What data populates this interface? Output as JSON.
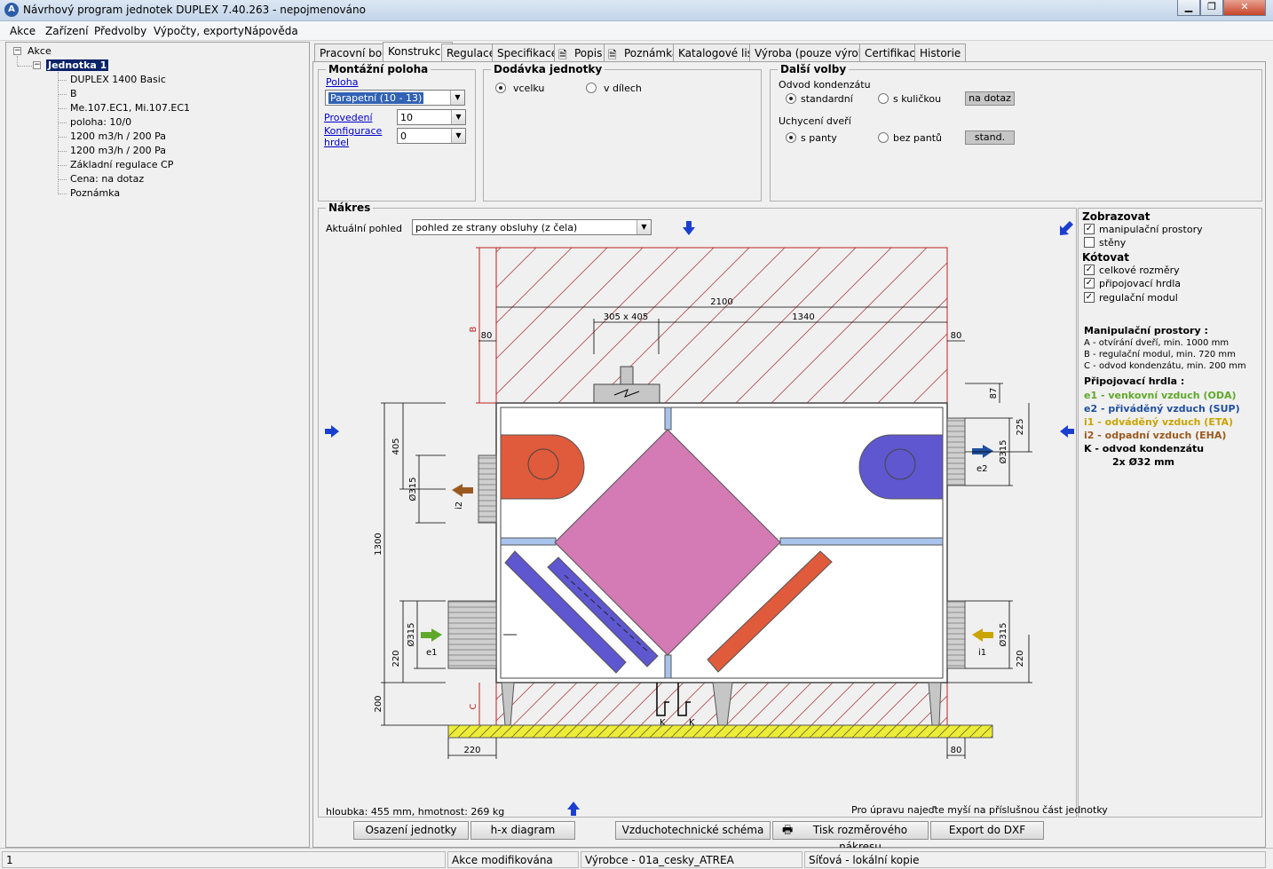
{
  "window": {
    "title": "Návrhový program jednotek DUPLEX 7.40.263 - nepojmenováno",
    "icon_name": "app-icon",
    "controls": [
      "minimize-icon",
      "restore-icon",
      "close-icon"
    ]
  },
  "menu": {
    "items": [
      "Akce",
      "Zařízení",
      "Předvolby",
      "Výpočty, exporty",
      "Nápověda"
    ]
  },
  "tree": {
    "root": "Akce",
    "unit": "Jednotka 1",
    "children": [
      "DUPLEX 1400 Basic",
      "B",
      "Me.107.EC1, Mi.107.EC1",
      "poloha: 10/0",
      "1200 m3/h / 200 Pa",
      "1200 m3/h / 200 Pa",
      "Základní regulace CP",
      "Cena: na dotaz",
      "Poznámka"
    ]
  },
  "tabs": [
    "Pracovní bod",
    "Konstrukce",
    "Regulace",
    "Specifikace",
    "Popis",
    "Poznámka",
    "Katalogové listy",
    "Výroba (pouze výrobce)",
    "Certifikace",
    "Historie"
  ],
  "active_tab": "Konstrukce",
  "mount": {
    "title": "Montážní poloha",
    "poloha_label": "Poloha",
    "poloha_value": "Parapetní   (10 - 13)",
    "provedeni_label": "Provedení",
    "provedeni_value": "10",
    "konfigurace_label_1": "Konfigurace",
    "konfigurace_label_2": "hrdel",
    "konfigurace_value": "0"
  },
  "delivery": {
    "title": "Dodávka jednotky",
    "opt1": "vcelku",
    "opt2": "v dílech"
  },
  "options": {
    "title": "Další volby",
    "odvod_label": "Odvod kondenzátu",
    "odvod_opt1": "standardní",
    "odvod_opt2": "s kuličkou",
    "odvod_btn": "na dotaz",
    "uchyceni_label": "Uchycení dveří",
    "uchyceni_opt1": "s panty",
    "uchyceni_opt2": "bez pantů",
    "uchyceni_btn": "stand."
  },
  "drawing": {
    "title": "Nákres",
    "view_label": "Aktuální pohled",
    "view_value": "pohled ze strany obsluhy (z čela)",
    "dims": {
      "width_total": "2100",
      "width_a": "305 x 405",
      "width_b": "1340",
      "left_80": "80",
      "right_80": "80",
      "b_label": "B",
      "c_label": "C",
      "h87": "87",
      "h225": "225",
      "h405": "405",
      "h1300": "1300",
      "h220_left": "220",
      "h220_right": "220",
      "h200": "200",
      "d315_i2": "Ø315",
      "d315_e1": "Ø315",
      "d315_e2": "Ø315",
      "d315_i1": "Ø315",
      "bottom_220": "220",
      "bottom_80": "80",
      "k1": "K",
      "k2": "K"
    },
    "ports": {
      "i2": "i2",
      "e1": "e1",
      "e2": "e2",
      "i1": "i1"
    },
    "footer_left": "hloubka: 455 mm, hmotnost: 269 kg",
    "footer_right": "Pro úpravu najeďte myší na příslušnou část jednotky"
  },
  "side": {
    "zobrazovat": "Zobrazovat",
    "z_opt1": "manipulační prostory",
    "z_opt2": "stěny",
    "kotovat": "Kótovat",
    "k_opt1": "celkové rozměry",
    "k_opt2": "připojovací hrdla",
    "k_opt3": "regulační modul",
    "manip_title": "Manipulační prostory :",
    "manip_a": "A - otvírání dveří, min. 1000 mm",
    "manip_b": "B - regulační modul, min. 720 mm",
    "manip_c": "C - odvod kondenzátu, min. 200 mm",
    "hrdla_title": "Připojovací hrdla :",
    "e1": "e1 - venkovní vzduch (ODA)",
    "e2": "e2 - přiváděný vzduch (SUP)",
    "i1": "i1 - odváděný vzduch (ETA)",
    "i2": "i2 - odpadní vzduch (EHA)",
    "k": "K   - odvod kondenzátu",
    "k2": "2x Ø32 mm",
    "colors": {
      "e1": "#5fa82a",
      "e2": "#1f4f9e",
      "i1": "#c9a400",
      "i2": "#9a5a1f"
    }
  },
  "buttons": [
    "Osazení jednotky",
    "h-x diagram",
    "Vzduchotechnické schéma",
    "Tisk rozměrového nákresu",
    "Export do DXF"
  ],
  "status": [
    "1",
    "Akce modifikována",
    "Výrobce - 01a_cesky_ATREA",
    "Síťová - lokální kopie"
  ]
}
